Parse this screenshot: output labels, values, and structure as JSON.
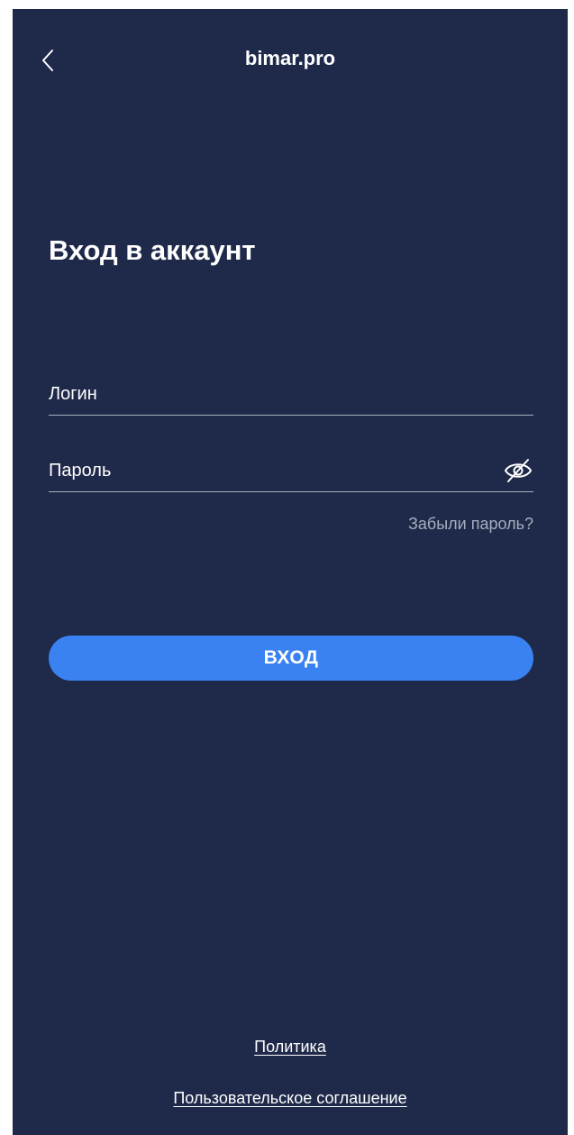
{
  "header": {
    "back_icon": "chevron-left-icon",
    "title": "bimar.pro"
  },
  "page_title": "Вход в аккаунт",
  "form": {
    "login_placeholder": "Логин",
    "login_value": "",
    "password_placeholder": "Пароль",
    "password_value": "",
    "password_visibility_icon": "eye-slash-icon",
    "forgot_password": "Забыли пароль?",
    "submit_label": "вход"
  },
  "footer": {
    "policy": "Политика",
    "agreement": "Пользовательское соглашение"
  },
  "colors": {
    "background": "#1f2a4a",
    "accent": "#3a82f1",
    "muted_text": "#a6adbd"
  }
}
